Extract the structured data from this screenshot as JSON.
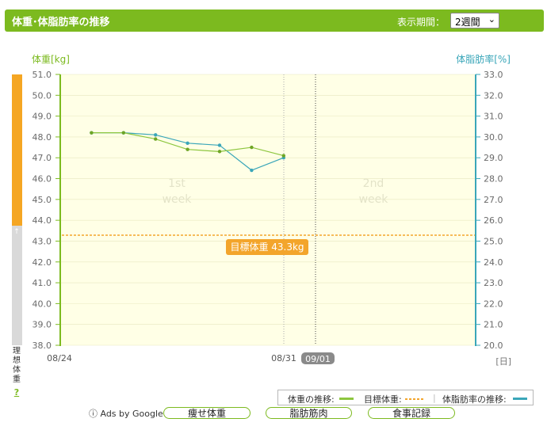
{
  "header": {
    "title": "体重･体脂肪率の推移",
    "period_label": "表示期間：",
    "period_value": "2週間",
    "period_arrow": "⌄"
  },
  "axes": {
    "left_label": "体重[kg]",
    "right_label": "体脂肪率[%]",
    "unit_label": "[日]",
    "side_label": "理想体重",
    "side_help": "?"
  },
  "weeks": {
    "week1": [
      "1st",
      "week"
    ],
    "week2": [
      "2nd",
      "week"
    ]
  },
  "today_label": "09/01",
  "goal_label": "目標体重 43.3kg",
  "legend": {
    "weight": "体重の推移:",
    "goal": "目標体重:",
    "fat": "体脂肪率の推移:"
  },
  "footer": {
    "ads": "ⓘ Ads by Google",
    "links": [
      "痩せ体重",
      "脂肪筋肉",
      "食事記録"
    ]
  },
  "colors": {
    "weight": "#8dc63f",
    "fat": "#3aa6b9",
    "goal": "#f3a52b",
    "plot_bg": "#ffffe6"
  },
  "chart_data": {
    "type": "line",
    "x_labels": [
      "08/24",
      "08/31"
    ],
    "weight_ylim": [
      38.0,
      51.0
    ],
    "fat_ylim": [
      20.0,
      33.0
    ],
    "weight_ticks": [
      "51.0",
      "50.0",
      "49.0",
      "48.0",
      "47.0",
      "46.0",
      "45.0",
      "44.0",
      "43.0",
      "42.0",
      "41.0",
      "40.0",
      "39.0",
      "38.0"
    ],
    "fat_ticks": [
      "33.0",
      "32.0",
      "31.0",
      "30.0",
      "29.0",
      "28.0",
      "27.0",
      "26.0",
      "25.0",
      "24.0",
      "23.0",
      "22.0",
      "21.0",
      "20.0"
    ],
    "days": [
      1,
      2,
      3,
      4,
      5,
      6,
      7
    ],
    "series": [
      {
        "values": [
          48.2,
          48.2,
          47.9,
          47.4,
          47.3,
          47.5,
          47.1
        ]
      },
      {
        "values": [
          30.2,
          30.2,
          30.1,
          29.7,
          29.6,
          28.4,
          29.0
        ]
      }
    ],
    "goal_weight": 43.3
  }
}
